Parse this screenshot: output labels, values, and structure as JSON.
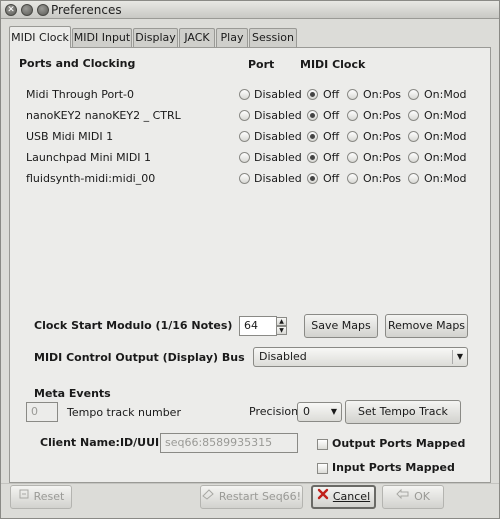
{
  "window": {
    "title": "Preferences"
  },
  "tabs": [
    {
      "label": "MIDI Clock"
    },
    {
      "label": "MIDI Input"
    },
    {
      "label": "Display"
    },
    {
      "label": "JACK"
    },
    {
      "label": "Play"
    },
    {
      "label": "Session"
    }
  ],
  "headers": {
    "ports_clocking": "Ports and Clocking",
    "port": "Port",
    "midi_clock": "MIDI Clock"
  },
  "port_options": {
    "disabled": "Disabled",
    "off": "Off",
    "on_pos": "On:Pos",
    "on_mod": "On:Mod"
  },
  "ports": [
    {
      "name": "Midi Through Port-0",
      "selected": "off"
    },
    {
      "name": "nanoKEY2 nanoKEY2 _ CTRL",
      "selected": "off"
    },
    {
      "name": "USB Midi MIDI 1",
      "selected": "off"
    },
    {
      "name": "Launchpad Mini MIDI 1",
      "selected": "off"
    },
    {
      "name": "fluidsynth-midi:midi_00",
      "selected": "off"
    }
  ],
  "clock_start": {
    "label": "Clock Start Modulo (1/16 Notes)",
    "value": "64"
  },
  "buttons": {
    "save_maps": "Save Maps",
    "remove_maps": "Remove Maps",
    "set_tempo_track": "Set Tempo Track",
    "reset": "Reset",
    "restart": "Restart Seq66!",
    "cancel": "Cancel",
    "ok": "OK"
  },
  "control_output": {
    "label": "MIDI Control Output (Display) Bus",
    "value": "Disabled"
  },
  "meta": {
    "heading": "Meta Events",
    "tempo_track_value": "0",
    "tempo_track_label": "Tempo track number",
    "precision_label": "Precision",
    "precision_value": "0"
  },
  "client": {
    "label": "Client Name:ID/UUID",
    "value": "seq66:8589935315"
  },
  "checks": {
    "output_mapped": "Output Ports Mapped",
    "input_mapped": "Input Ports Mapped"
  }
}
